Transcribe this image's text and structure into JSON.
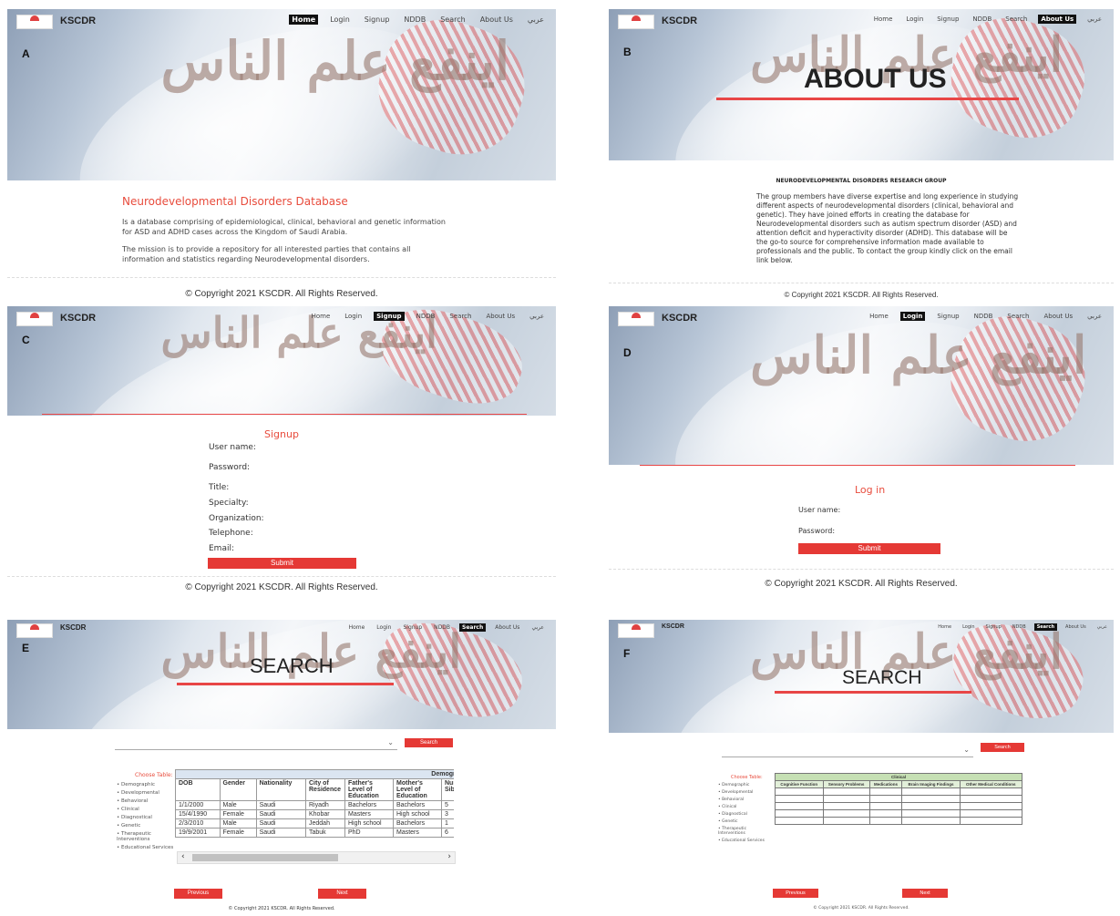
{
  "nav": {
    "brand": "KSCDR",
    "items": [
      "Home",
      "Login",
      "Signup",
      "NDDB",
      "Search",
      "About Us",
      "عربي"
    ]
  },
  "hero_arabic": "اينفع علم الناس",
  "footer": "© Copyright 2021 KSCDR. All Rights Reserved.",
  "panels": {
    "A": {
      "label": "A",
      "title": "Neurodevelopmental Disorders Database",
      "para1": "Is a database comprising of epidemiological, clinical, behavioral and genetic information for ASD and ADHD cases across the Kingdom of Saudi Arabia.",
      "para2": "The mission is to provide a repository for all interested parties that contains all information and statistics regarding Neurodevelopmental disorders."
    },
    "B": {
      "label": "B",
      "hero_title": "ABOUT US",
      "group_title": "NEURODEVELOPMENTAL DISORDERS RESEARCH GROUP",
      "body": "The group members have diverse expertise and long experience in studying different aspects of neurodevelopmental disorders (clinical, behavioral and genetic). They have joined efforts in creating the database for Neurodevelopmental disorders such as autism spectrum disorder (ASD) and attention deficit and hyperactivity disorder (ADHD). This database will be the go-to source for comprehensive information made available to professionals and the public. To contact the group kindly click on the email link below."
    },
    "C": {
      "label": "C",
      "form_title": "Signup",
      "fields": [
        "User name:",
        "Password:",
        "Title:",
        "Specialty:",
        "Organization:",
        "Telephone:",
        "Email:"
      ],
      "submit": "Submit"
    },
    "D": {
      "label": "D",
      "form_title": "Log in",
      "fields": [
        "User name:",
        "Password:"
      ],
      "submit": "Submit"
    },
    "E": {
      "label": "E",
      "hero_title": "SEARCH",
      "search_btn": "Search",
      "choose_label": "Choose Table:",
      "tables": [
        "Demographic",
        "Developmental",
        "Behavioral",
        "Clinical",
        "Diagnostical",
        "Genetic",
        "Therapeutic Interventions",
        "Educational Services"
      ],
      "group_header": "Demographic",
      "columns": [
        "DOB",
        "Gender",
        "Nationality",
        "City of Residence",
        "Father's Level of Education",
        "Mother's Level of Education",
        "Number Sibling(s"
      ],
      "rows": [
        [
          "1/1/2000",
          "Male",
          "Saudi",
          "Riyadh",
          "Bachelors",
          "Bachelors",
          "5"
        ],
        [
          "15/4/1990",
          "Female",
          "Saudi",
          "Khobar",
          "Masters",
          "High school",
          "3"
        ],
        [
          "2/3/2010",
          "Male",
          "Saudi",
          "Jeddah",
          "High school",
          "Bachelors",
          "1"
        ],
        [
          "19/9/2001",
          "Female",
          "Saudi",
          "Tabuk",
          "PhD",
          "Masters",
          "6"
        ]
      ],
      "prev": "Previous",
      "next": "Next"
    },
    "F": {
      "label": "F",
      "hero_title": "SEARCH",
      "search_btn": "Search",
      "choose_label": "Choose Table:",
      "tables": [
        "Demographic",
        "Developmental",
        "Behavioral",
        "Clinical",
        "Diagnostical",
        "Genetic",
        "Therapeutic Interventions",
        "Educational Services"
      ],
      "group_header": "Clinical",
      "columns": [
        "Cognitive Function",
        "Sensory Problems",
        "Medications",
        "Brain Imaging Findings",
        "Other Medical Conditions"
      ],
      "prev": "Previous",
      "next": "Next"
    }
  },
  "colors": {
    "accent": "#e53935",
    "title_red": "#e84c3d",
    "nav_active": "#111111"
  }
}
